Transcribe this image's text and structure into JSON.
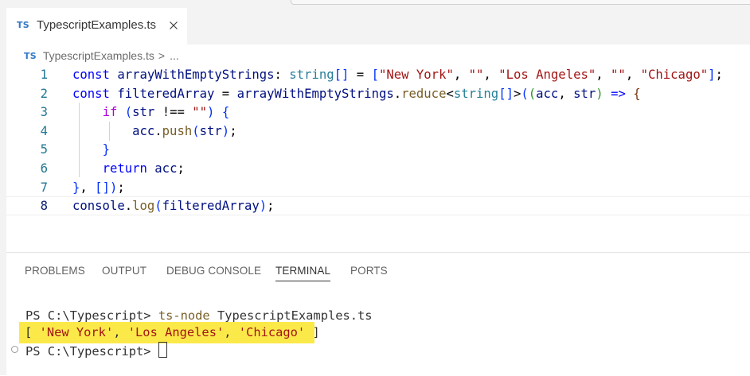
{
  "tab": {
    "badge": "TS",
    "filename": "TypescriptExamples.ts"
  },
  "breadcrumb": {
    "badge": "TS",
    "file": "TypescriptExamples.ts",
    "separator": ">",
    "ellipsis": "..."
  },
  "editor": {
    "line_numbers": [
      "1",
      "2",
      "3",
      "4",
      "5",
      "6",
      "7",
      "8"
    ],
    "lines": [
      "const arrayWithEmptyStrings: string[] = [\"New York\", \"\", \"Los Angeles\", \"\", \"Chicago\"];",
      "const filteredArray = arrayWithEmptyStrings.reduce<string[]>((acc, str) => {",
      "    if (str !== \"\") {",
      "        acc.push(str);",
      "    }",
      "    return acc;",
      "}, []);",
      "console.log(filteredArray);"
    ],
    "current_line": 8
  },
  "panel": {
    "tabs": [
      "PROBLEMS",
      "OUTPUT",
      "DEBUG CONSOLE",
      "TERMINAL",
      "PORTS"
    ],
    "active_tab": "TERMINAL"
  },
  "terminal": {
    "prompt": "PS C:\\Typescript>",
    "command": "ts-node",
    "argument": "TypescriptExamples.ts",
    "output": "[ 'New York', 'Los Angeles', 'Chicago' ]",
    "output_parts": [
      "[ ",
      "'New York'",
      ", ",
      "'Los Angeles'",
      ", ",
      "'Chicago'",
      " ]"
    ]
  },
  "colors": {
    "highlight": "#fbe94a",
    "keyword": "#0000ff",
    "string": "#a31515",
    "ts_badge": "#3178c6"
  }
}
